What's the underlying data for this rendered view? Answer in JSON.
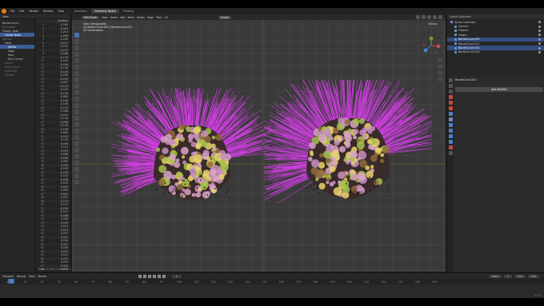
{
  "menu": {
    "items": [
      "File",
      "Edit",
      "Render",
      "Window",
      "Help"
    ],
    "workspaces": [
      "Animation",
      "Geometry Nodes",
      "Shading"
    ],
    "active_workspace": "Geometry Nodes",
    "scene": "Scene",
    "view_layer": "ViewLayer"
  },
  "spreadsheet": {
    "header": "View",
    "object_label": "BezierCurve...",
    "tree": [
      {
        "label": "Evaluated",
        "cls": "dim"
      },
      {
        "label": "Viewer node",
        "cls": ""
      },
      {
        "label": "Viewer Node",
        "cls": "sel i1"
      },
      {
        "label": "Domain",
        "cls": "dim"
      },
      {
        "label": "Mesh",
        "cls": "i1"
      },
      {
        "label": "Vertex",
        "cls": "sel i2"
      },
      {
        "label": "Edge",
        "cls": "i2"
      },
      {
        "label": "Face",
        "cls": "i2"
      },
      {
        "label": "Face Corner",
        "cls": "i2"
      },
      {
        "label": "Curve",
        "cls": "dim i1"
      },
      {
        "label": "Point Cloud",
        "cls": "dim i1"
      },
      {
        "label": "Instances",
        "cls": "dim i1"
      },
      {
        "label": "Volume",
        "cls": "dim i1"
      }
    ],
    "col_header": "position",
    "rows": [
      [
        "0",
        "-0.184"
      ],
      [
        "1",
        "-0.053"
      ],
      [
        "2",
        "0.214"
      ],
      [
        "3",
        "-0.256"
      ],
      [
        "4",
        "-0.256"
      ],
      [
        "5",
        "-0.217"
      ],
      [
        "6",
        "-0.235"
      ],
      [
        "7",
        "-0.173"
      ],
      [
        "8",
        "-0.188"
      ],
      [
        "9",
        "-0.174"
      ],
      [
        "10",
        "-0.155"
      ],
      [
        "11",
        "-0.194"
      ],
      [
        "12",
        "-0.176"
      ],
      [
        "13",
        "-0.134"
      ],
      [
        "14",
        "-0.165"
      ],
      [
        "15",
        "-0.152"
      ],
      [
        "16",
        "-0.097"
      ],
      [
        "17",
        "-0.114"
      ],
      [
        "18",
        "-0.133"
      ],
      [
        "19",
        "-0.135"
      ],
      [
        "20",
        "-0.084"
      ],
      [
        "21",
        "-0.140"
      ],
      [
        "22",
        "-0.146"
      ],
      [
        "23",
        "-0.174"
      ],
      [
        "24",
        "-0.168"
      ],
      [
        "25",
        "-0.141"
      ],
      [
        "26",
        "-0.118"
      ],
      [
        "27",
        "-0.186"
      ],
      [
        "28",
        "-0.118"
      ],
      [
        "29",
        "-0.199"
      ],
      [
        "30",
        "-0.094"
      ],
      [
        "31",
        "-0.152"
      ],
      [
        "32",
        "0.179"
      ],
      [
        "33",
        "0.194"
      ],
      [
        "34",
        "0.113"
      ],
      [
        "35",
        "0.133"
      ],
      [
        "36",
        "0.098"
      ],
      [
        "37",
        "0.156"
      ],
      [
        "38",
        "0.092"
      ],
      [
        "39",
        "0.192"
      ],
      [
        "40",
        "-0.105"
      ],
      [
        "41",
        "-0.210"
      ],
      [
        "42",
        "-0.132"
      ],
      [
        "43",
        "-0.018"
      ],
      [
        "44",
        "-0.013"
      ],
      [
        "45",
        "-0.020"
      ],
      [
        "46",
        "0.035"
      ],
      [
        "47",
        "0.054"
      ],
      [
        "48",
        "-0.051"
      ],
      [
        "49",
        "0.173"
      ],
      [
        "50",
        "-0.147"
      ],
      [
        "51",
        "-0.210"
      ],
      [
        "52",
        "-0.222"
      ],
      [
        "53",
        "-0.186"
      ],
      [
        "54",
        "0.059"
      ],
      [
        "55",
        "0.143"
      ],
      [
        "56",
        "0.214"
      ],
      [
        "57",
        "0.213"
      ],
      [
        "58",
        "0.257"
      ],
      [
        "59",
        "0.247"
      ],
      [
        "60",
        "0.244"
      ],
      [
        "61",
        "0.227"
      ],
      [
        "62",
        "0.226"
      ],
      [
        "63",
        "0.223"
      ],
      [
        "64",
        "0.122"
      ],
      [
        "65",
        "0.213"
      ],
      [
        "66",
        "0.219"
      ],
      [
        "67",
        "0.229"
      ],
      [
        "68",
        "0.229"
      ]
    ],
    "footer": "Rows: 2,416  |  Columns: 3"
  },
  "viewport": {
    "mode": "Edit Mode",
    "menus": [
      "View",
      "Select",
      "Add",
      "Mesh",
      "Vertex",
      "Edge",
      "Face",
      "UV"
    ],
    "snap": "Global",
    "info_lines": [
      "User Orthographic",
      "(1) BezierCurve.003 | BezierCurve.011",
      "30 Centimeters"
    ],
    "options": "Options",
    "hair_color": "#d43fe6",
    "flower_colors": [
      "#c98fbf",
      "#a4c14b",
      "#d9a3c7",
      "#8f6b3a",
      "#e8d36a"
    ]
  },
  "outliner": {
    "header": "Scene Collection",
    "rows": [
      {
        "label": "Scene Collection",
        "cls": ""
      },
      {
        "label": "Camera",
        "cls": "i1"
      },
      {
        "label": "Flowers",
        "cls": "i1"
      },
      {
        "label": "Flower",
        "cls": "i1"
      },
      {
        "label": "BezierCurve.003",
        "cls": "i1 sel"
      },
      {
        "label": "BezierCurve.011",
        "cls": "i1"
      },
      {
        "label": "BezierCurve.014",
        "cls": "i1 sel"
      },
      {
        "label": "BezierCurve.016",
        "cls": "i1"
      }
    ]
  },
  "properties": {
    "object": "BezierCurve.003",
    "add_modifier": "Add Modifier"
  },
  "timeline": {
    "menus": [
      "Playback",
      "Keying",
      "View",
      "Marker"
    ],
    "frame": "1",
    "start_label": "Start",
    "start": "1",
    "end_label": "End",
    "end": "250",
    "ruler": [
      "0",
      "10",
      "20",
      "30",
      "40",
      "50",
      "60",
      "70",
      "80",
      "90",
      "100",
      "110",
      "120",
      "130",
      "140",
      "150",
      "160",
      "170",
      "180",
      "190",
      "200",
      "210",
      "220",
      "230",
      "240",
      "250"
    ],
    "version": "3.0.0"
  }
}
